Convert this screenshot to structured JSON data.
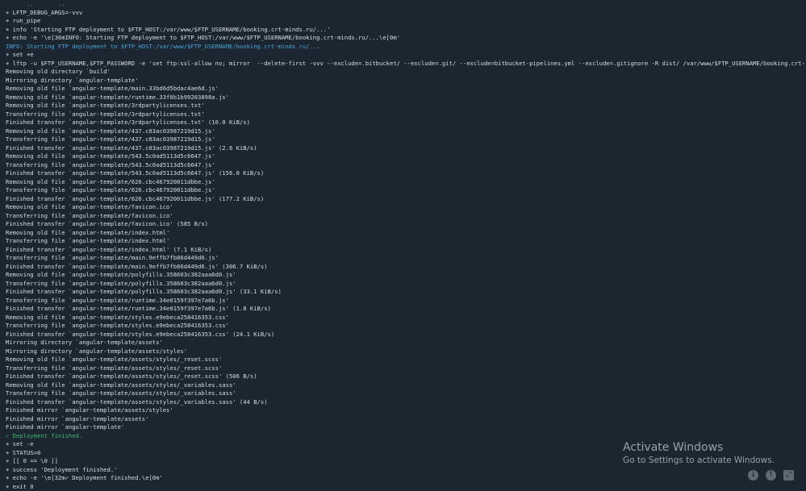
{
  "terminal": {
    "lines": [
      {
        "text": "      ..       ..",
        "style": "faint"
      },
      {
        "text": "+ LFTP_DEBUG_ARGS=-vvv",
        "style": "normal"
      },
      {
        "text": "+ run_pipe",
        "style": "normal"
      },
      {
        "text": "+ info 'Starting FTP deployment to $FTP_HOST:/var/www/$FTP_USERNAME/booking.crt-minds.ru/...'",
        "style": "normal"
      },
      {
        "text": "+ echo -e '\\e[36mINFO: Starting FTP deployment to $FTP_HOST:/var/www/$FTP_USERNAME/booking.crt-minds.ru/...\\e[0m'",
        "style": "normal"
      },
      {
        "text": "INFO: Starting FTP deployment to $FTP_HOST:/var/www/$FTP_USERNAME/booking.crt-minds.ru/...",
        "style": "info"
      },
      {
        "text": "+ set +e",
        "style": "normal"
      },
      {
        "text": "+ lftp -u $FTP_USERNAME,$FTP_PASSWORD -e 'set ftp:ssl-allow no; mirror  --delete-first -vvv --exclude=.bitbucket/ --exclude=.git/ --exclude=bitbucket-pipelines.yml --exclude=.gitignore -R dist/ /var/www/$FTP_USERNAME/booking.crt-minds.ru/;quit' $FTP_HOST",
        "style": "normal"
      },
      {
        "text": "Removing old directory `build'",
        "style": "normal"
      },
      {
        "text": "Mirroring directory `angular-template'",
        "style": "normal"
      },
      {
        "text": "Removing old file `angular-template/main.33bd6d5bdac4ae6d.js'",
        "style": "normal"
      },
      {
        "text": "Removing old file `angular-template/runtime.33f0b1b99203898a.js'",
        "style": "normal"
      },
      {
        "text": "Removing old file `angular-template/3rdpartylicenses.txt'",
        "style": "normal"
      },
      {
        "text": "Transferring file `angular-template/3rdpartylicenses.txt'",
        "style": "normal"
      },
      {
        "text": "Finished transfer `angular-template/3rdpartylicenses.txt' (10.0 KiB/s)",
        "style": "normal"
      },
      {
        "text": "Removing old file `angular-template/437.c03ac03987219d15.js'",
        "style": "normal"
      },
      {
        "text": "Transferring file `angular-template/437.c03ac03987219d15.js'",
        "style": "normal"
      },
      {
        "text": "Finished transfer `angular-template/437.c03ac03987219d15.js' (2.6 KiB/s)",
        "style": "normal"
      },
      {
        "text": "Removing old file `angular-template/543.5c0ad5113d5c6647.js'",
        "style": "normal"
      },
      {
        "text": "Transferring file `angular-template/543.5c0ad5113d5c6647.js'",
        "style": "normal"
      },
      {
        "text": "Finished transfer `angular-template/543.5c0ad5113d5c6647.js' (156.0 KiB/s)",
        "style": "normal"
      },
      {
        "text": "Removing old file `angular-template/626.cbc467920011dbbe.js'",
        "style": "normal"
      },
      {
        "text": "Transferring file `angular-template/626.cbc467920011dbbe.js'",
        "style": "normal"
      },
      {
        "text": "Finished transfer `angular-template/626.cbc467920011dbbe.js' (177.2 KiB/s)",
        "style": "normal"
      },
      {
        "text": "Removing old file `angular-template/favicon.ico'",
        "style": "normal"
      },
      {
        "text": "Transferring file `angular-template/favicon.ico'",
        "style": "normal"
      },
      {
        "text": "Finished transfer `angular-template/favicon.ico' (585 B/s)",
        "style": "normal"
      },
      {
        "text": "Removing old file `angular-template/index.html'",
        "style": "normal"
      },
      {
        "text": "Transferring file `angular-template/index.html'",
        "style": "normal"
      },
      {
        "text": "Finished transfer `angular-template/index.html' (7.1 KiB/s)",
        "style": "normal"
      },
      {
        "text": "Transferring file `angular-template/main.9effb7fb86d449d6.js'",
        "style": "normal"
      },
      {
        "text": "Finished transfer `angular-template/main.9effb7fb86d449d6.js' (306.7 KiB/s)",
        "style": "normal"
      },
      {
        "text": "Removing old file `angular-template/polyfills.358603c382aaa6d0.js'",
        "style": "normal"
      },
      {
        "text": "Transferring file `angular-template/polyfills.358603c382aaa6d0.js'",
        "style": "normal"
      },
      {
        "text": "Finished transfer `angular-template/polyfills.358603c382aaa6d0.js' (33.1 KiB/s)",
        "style": "normal"
      },
      {
        "text": "Transferring file `angular-template/runtime.34e0159f397e7a6b.js'",
        "style": "normal"
      },
      {
        "text": "Finished transfer `angular-template/runtime.34e0159f397e7a6b.js' (1.8 KiB/s)",
        "style": "normal"
      },
      {
        "text": "Removing old file `angular-template/styles.e9ebeca258416353.css'",
        "style": "normal"
      },
      {
        "text": "Transferring file `angular-template/styles.e9ebeca258416353.css'",
        "style": "normal"
      },
      {
        "text": "Finished transfer `angular-template/styles.e9ebeca258416353.css' (24.1 KiB/s)",
        "style": "normal"
      },
      {
        "text": "Mirroring directory `angular-template/assets'",
        "style": "normal"
      },
      {
        "text": "Mirroring directory `angular-template/assets/styles'",
        "style": "normal"
      },
      {
        "text": "Removing old file `angular-template/assets/styles/_reset.scss'",
        "style": "normal"
      },
      {
        "text": "Transferring file `angular-template/assets/styles/_reset.scss'",
        "style": "normal"
      },
      {
        "text": "Finished transfer `angular-template/assets/styles/_reset.scss' (506 B/s)",
        "style": "normal"
      },
      {
        "text": "Removing old file `angular-template/assets/styles/_variables.sass'",
        "style": "normal"
      },
      {
        "text": "Transferring file `angular-template/assets/styles/_variables.sass'",
        "style": "normal"
      },
      {
        "text": "Finished transfer `angular-template/assets/styles/_variables.sass' (44 B/s)",
        "style": "normal"
      },
      {
        "text": "Finished mirror `angular-template/assets/styles'",
        "style": "normal"
      },
      {
        "text": "Finished mirror `angular-template/assets'",
        "style": "normal"
      },
      {
        "text": "Finished mirror `angular-template'",
        "style": "normal"
      },
      {
        "text": "✓ Deployment finished.",
        "style": "success"
      },
      {
        "text": "+ set -e",
        "style": "normal"
      },
      {
        "text": "+ STATUS=0",
        "style": "normal"
      },
      {
        "text": "+ [[ 0 == \\0 ]]",
        "style": "normal"
      },
      {
        "text": "+ success 'Deployment finished.'",
        "style": "normal"
      },
      {
        "text": "+ echo -e '\\e[32m✓ Deployment finished.\\e[0m'",
        "style": "normal"
      },
      {
        "text": "+ exit 0",
        "style": "normal"
      }
    ]
  },
  "watermark": {
    "title": "Activate Windows",
    "subtitle": "Go to Settings to activate Windows."
  },
  "controls": [
    {
      "name": "scroll-down-button",
      "icon": "arrow-down-icon",
      "glyph": "↓"
    },
    {
      "name": "scroll-up-button",
      "icon": "arrow-up-icon",
      "glyph": "↑"
    },
    {
      "name": "fullscreen-button",
      "icon": "expand-icon",
      "glyph": "⤢"
    }
  ]
}
